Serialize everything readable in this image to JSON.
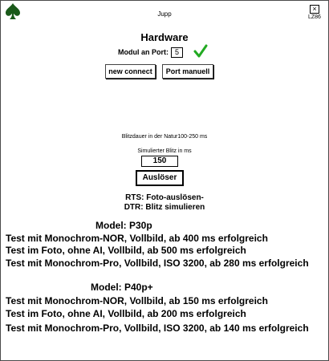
{
  "window": {
    "title": "Jupp",
    "close_glyph": "×",
    "corner_code": "LZ86",
    "logo_icon": "spade-icon"
  },
  "hardware": {
    "heading": "Hardware",
    "port_label": "Modul an Port:",
    "port_value": "5",
    "status_icon": "checkmark-icon",
    "status_color": "#22aa22",
    "new_connect_label": "new connect",
    "port_manual_label": "Port manuell"
  },
  "flash": {
    "duration_text": "Blitzdauer in der Natur100-250 ms",
    "simulated_label": "Simulierter Blitz in ms",
    "simulated_value": "150",
    "trigger_label": "Auslöser"
  },
  "signals": {
    "rts": "RTS: Foto-auslösen-",
    "dtr": "DTR: Blitz simulieren"
  },
  "models": [
    {
      "name": "Model: P30p",
      "tests": [
        "Test mit Monochrom-NOR, Vollbild, ab 400 ms erfolgreich",
        "Test im Foto, ohne AI, Vollbild, ab 500 ms erfolgreich",
        "Test mit Monochrom-Pro, Vollbild, ISO 3200, ab 280 ms erfolgreich"
      ]
    },
    {
      "name": "Model: P40p+",
      "tests": [
        "Test mit Monochrom-NOR, Vollbild, ab 150 ms erfolgreich",
        "Test im Foto, ohne AI, Vollbild, ab 200 ms erfolgreich",
        "Test mit Monochrom-Pro, Vollbild, ISO 3200, ab 140 ms erfolgreich"
      ]
    }
  ]
}
